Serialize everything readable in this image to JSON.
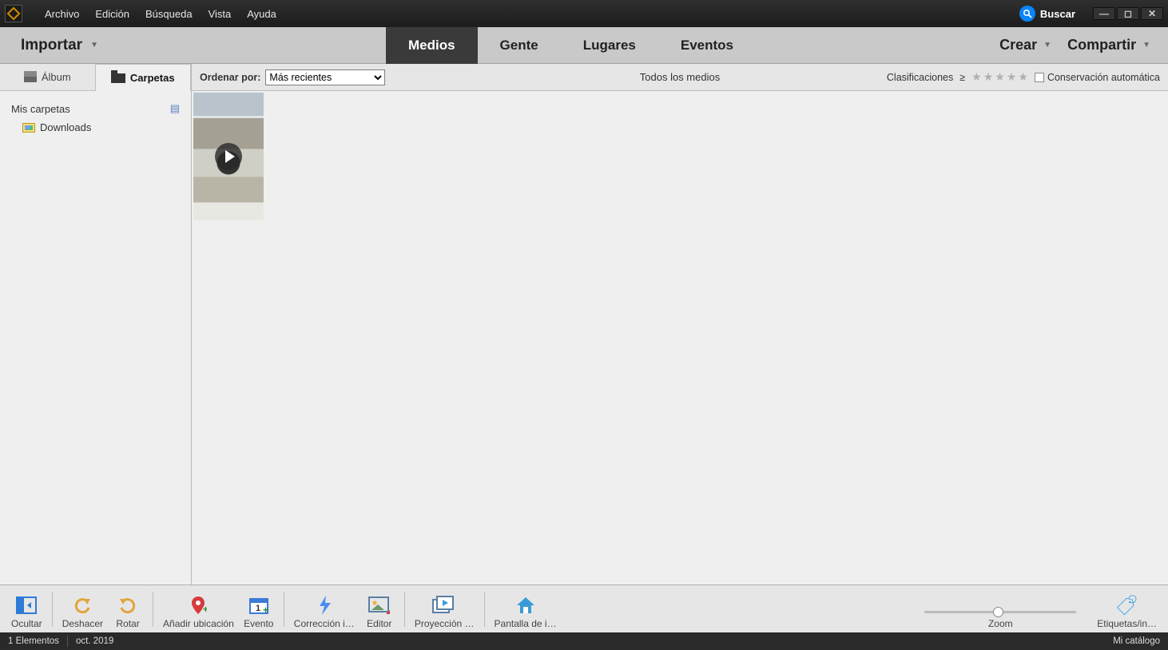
{
  "menubar": {
    "items": [
      "Archivo",
      "Edición",
      "Búsqueda",
      "Vista",
      "Ayuda"
    ],
    "search_label": "Buscar"
  },
  "toolbar": {
    "import_label": "Importar",
    "tabs": [
      "Medios",
      "Gente",
      "Lugares",
      "Eventos"
    ],
    "active_tab_index": 0,
    "create_label": "Crear",
    "share_label": "Compartir"
  },
  "side": {
    "tabs": {
      "album": "Álbum",
      "folders": "Carpetas"
    },
    "active": "folders",
    "my_folders_label": "Mis carpetas",
    "tree": [
      {
        "name": "Downloads"
      }
    ]
  },
  "filterbar": {
    "sort_label": "Ordenar por:",
    "sort_value": "Más recientes",
    "center_label": "Todos los medios",
    "ratings_label": "Clasificaciones",
    "gte_symbol": "≥",
    "auto_curate_label": "Conservación automática"
  },
  "bottombar": {
    "hide": "Ocultar",
    "undo": "Deshacer",
    "rotate": "Rotar",
    "add_location": "Añadir ubicación",
    "event": "Evento",
    "instant_fix": "Corrección i…",
    "editor": "Editor",
    "slideshow": "Proyección …",
    "start_screen": "Pantalla de i…",
    "zoom": "Zoom",
    "tags": "Etiquetas/in…"
  },
  "statusbar": {
    "count": "1 Elementos",
    "date": "oct. 2019",
    "catalog": "Mi catálogo"
  }
}
